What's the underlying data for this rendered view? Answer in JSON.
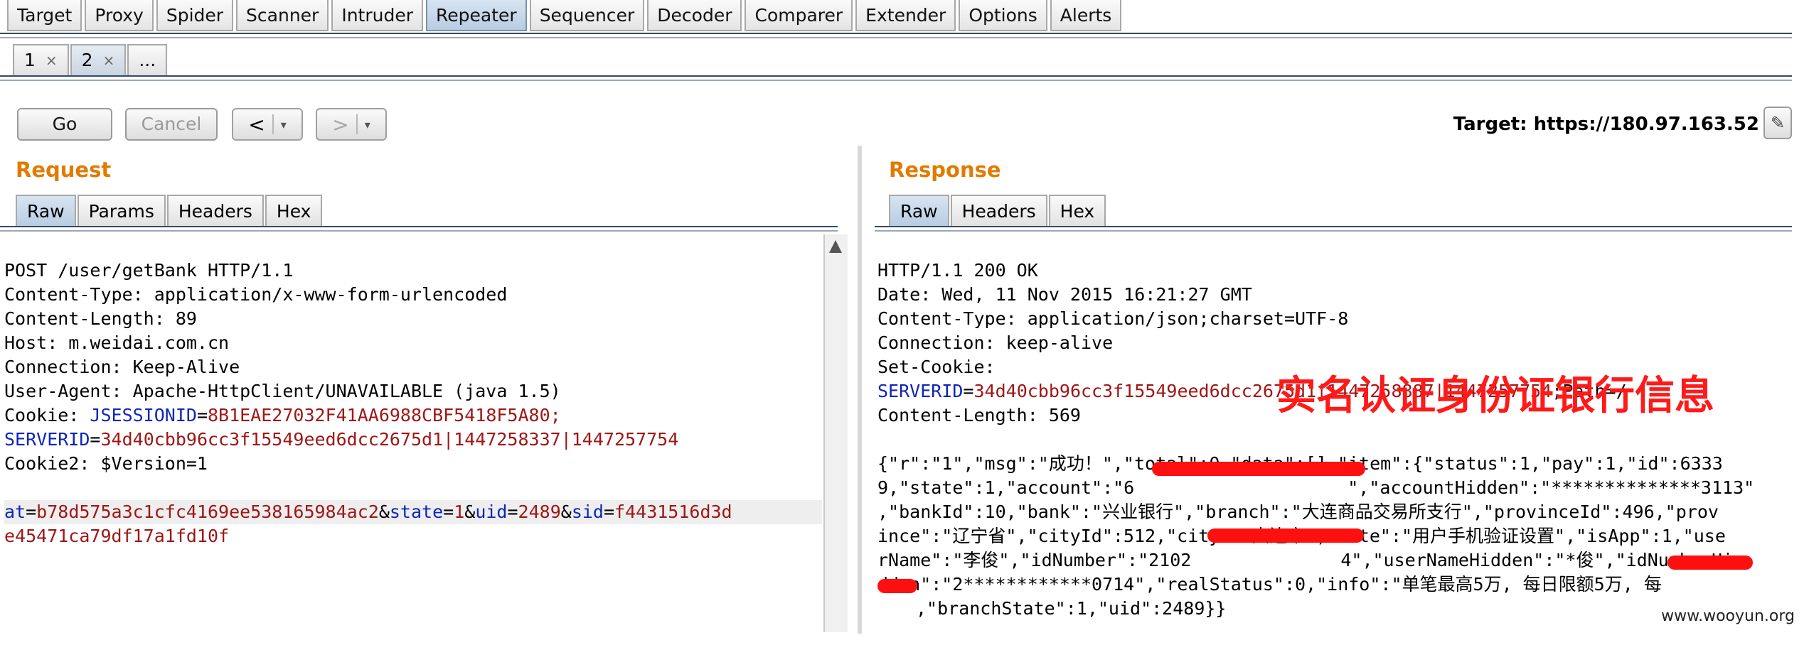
{
  "main_tabs": [
    "Target",
    "Proxy",
    "Spider",
    "Scanner",
    "Intruder",
    "Repeater",
    "Sequencer",
    "Decoder",
    "Comparer",
    "Extender",
    "Options",
    "Alerts"
  ],
  "active_main_tab": "Repeater",
  "sub_tabs": [
    {
      "label": "1",
      "close": "×"
    },
    {
      "label": "2",
      "close": "×"
    }
  ],
  "sub_tab_more": "...",
  "toolbar": {
    "go": "Go",
    "cancel": "Cancel",
    "back": "<",
    "forward": ">",
    "dropdown": "▾"
  },
  "target": "Target: https://180.97.163.52",
  "request": {
    "heading": "Request",
    "tabs": [
      "Raw",
      "Params",
      "Headers",
      "Hex"
    ],
    "lines": [
      "POST /user/getBank HTTP/1.1",
      "Content-Type: application/x-www-form-urlencoded",
      "Content-Length: 89",
      "Host: m.weidai.com.cn",
      "Connection: Keep-Alive",
      "User-Agent: Apache-HttpClient/UNAVAILABLE (java 1.5)"
    ],
    "cookie_label": "Cookie: ",
    "cookie_k1": "JSESSIONID",
    "cookie_v1": "8B1EAE27032F41AA6988CBF5418F5A80;",
    "cookie_k2": "SERVERID",
    "cookie_v2": "34d40cbb96cc3f15549eed6dcc2675d1|1447258337|1447257754",
    "cookie2": "Cookie2: $Version=1",
    "body_k1": "at",
    "body_v1": "b78d575a3c1cfc4169ee538165984ac2",
    "body_k2": "state",
    "body_v2": "1",
    "body_k3": "uid",
    "body_v3": "2489",
    "body_k4": "sid",
    "body_v4": "f4431516d3d",
    "body_cont": "e45471ca79df17a1fd10f"
  },
  "response": {
    "heading": "Response",
    "tabs": [
      "Raw",
      "Headers",
      "Hex"
    ],
    "lines": [
      "HTTP/1.1 200 OK",
      "Date: Wed, 11 Nov 2015 16:21:27 GMT",
      "Content-Type: application/json;charset=UTF-8",
      "Connection: keep-alive",
      "Set-Cookie:"
    ],
    "setcookie_k": "SERVERID",
    "setcookie_v": "34d40cbb96cc3f15549eed6dcc2675d1|1447258887|1447257754",
    "setcookie_rest": ";Path=/",
    "content_length": "Content-Length: 569",
    "json_lines": [
      "{\"r\":\"1\",\"msg\":\"成功！\",\"total\":0,\"data\":[],\"item\":{\"status\":1,\"pay\":1,\"id\":6333",
      "9,\"state\":1,\"account\":\"6",
      "\",\"accountHidden\":\"**************3113\"",
      ",\"bankId\":10,\"bank\":\"兴业银行\",\"branch\":\"大连商品交易所支行\",\"provinceId\":496,\"prov",
      "ince\":\"辽宁省\",\"cityId\":512,\"city\":\"大连市\",\"note\":\"用户手机验证设置\",\"isApp\":1,\"use",
      "rName\":\"李俊\",\"idNumber\":\"2102",
      "4\",\"userNameHidden\":\"*俊\",\"idNumberHi",
      "dden\":\"2************0714\",\"realStatus\":0,\"info\":\"单笔最高5万, 每日限额5万, 每",
      ",\"branchState\":1,\"uid\":2489}}"
    ]
  },
  "annotation": "实名认证身份证银行信息",
  "watermark": "www.wooyun.org",
  "colors": {
    "accent_orange": "#e07b00",
    "key_blue": "#0f25b8",
    "value_red": "#a01616",
    "redaction": "#ff1010"
  }
}
